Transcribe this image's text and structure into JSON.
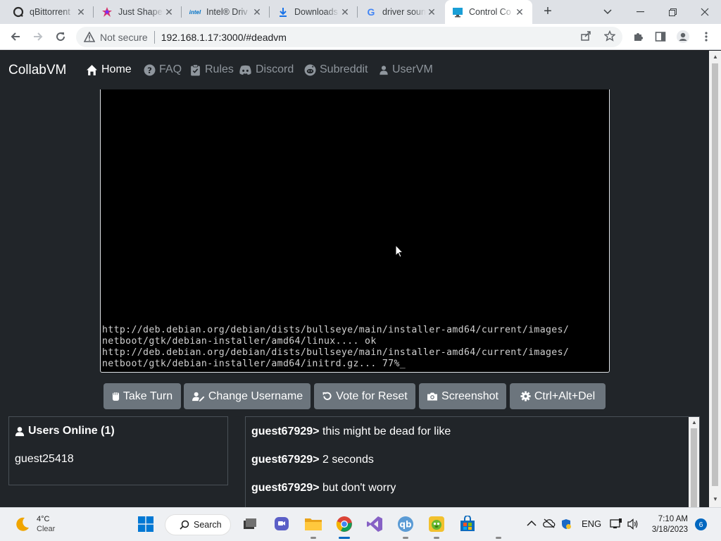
{
  "browser": {
    "tabs": [
      {
        "title": "qBittorrent",
        "icon": "qbittorrent-icon"
      },
      {
        "title": "Just Shapes",
        "icon": "game-icon"
      },
      {
        "title": "Intel® Driv",
        "icon": "intel-icon"
      },
      {
        "title": "Downloads",
        "icon": "download-icon"
      },
      {
        "title": "driver soun",
        "icon": "google-icon"
      },
      {
        "title": "Control Co",
        "icon": "monitor-icon"
      }
    ],
    "security_label": "Not secure",
    "url": "192.168.1.17:3000/#deadvm"
  },
  "site": {
    "brand": "CollabVM",
    "nav": [
      {
        "label": "Home",
        "icon": "home-icon"
      },
      {
        "label": "FAQ",
        "icon": "question-icon"
      },
      {
        "label": "Rules",
        "icon": "clipboard-icon"
      },
      {
        "label": "Discord",
        "icon": "discord-icon"
      },
      {
        "label": "Subreddit",
        "icon": "reddit-icon"
      },
      {
        "label": "UserVM",
        "icon": "user-icon"
      }
    ]
  },
  "vm": {
    "console_lines": [
      "http://deb.debian.org/debian/dists/bullseye/main/installer-amd64/current/images/",
      "netboot/gtk/debian-installer/amd64/linux.... ok",
      "http://deb.debian.org/debian/dists/bullseye/main/installer-amd64/current/images/",
      "netboot/gtk/debian-installer/amd64/initrd.gz... 77%_"
    ]
  },
  "controls": {
    "take_turn": "Take Turn",
    "change_username": "Change Username",
    "vote_reset": "Vote for Reset",
    "screenshot": "Screenshot",
    "ctrl_alt_del": "Ctrl+Alt+Del"
  },
  "users_panel": {
    "title": "Users Online (1)",
    "users": [
      "guest25418"
    ]
  },
  "chat": {
    "messages": [
      {
        "user": "guest67929>",
        "text": "this might be dead for like"
      },
      {
        "user": "guest67929>",
        "text": "2 seconds"
      },
      {
        "user": "guest67929>",
        "text": "but don't worry"
      }
    ]
  },
  "taskbar": {
    "weather_temp": "4°C",
    "weather_desc": "Clear",
    "search_label": "Search",
    "language": "ENG",
    "time": "7:10 AM",
    "date": "3/18/2023",
    "notification_count": "6"
  },
  "colors": {
    "page_bg": "#212529",
    "button_bg": "#6c757d",
    "nav_inactive": "#8f969d",
    "accent": "#0067c0"
  }
}
